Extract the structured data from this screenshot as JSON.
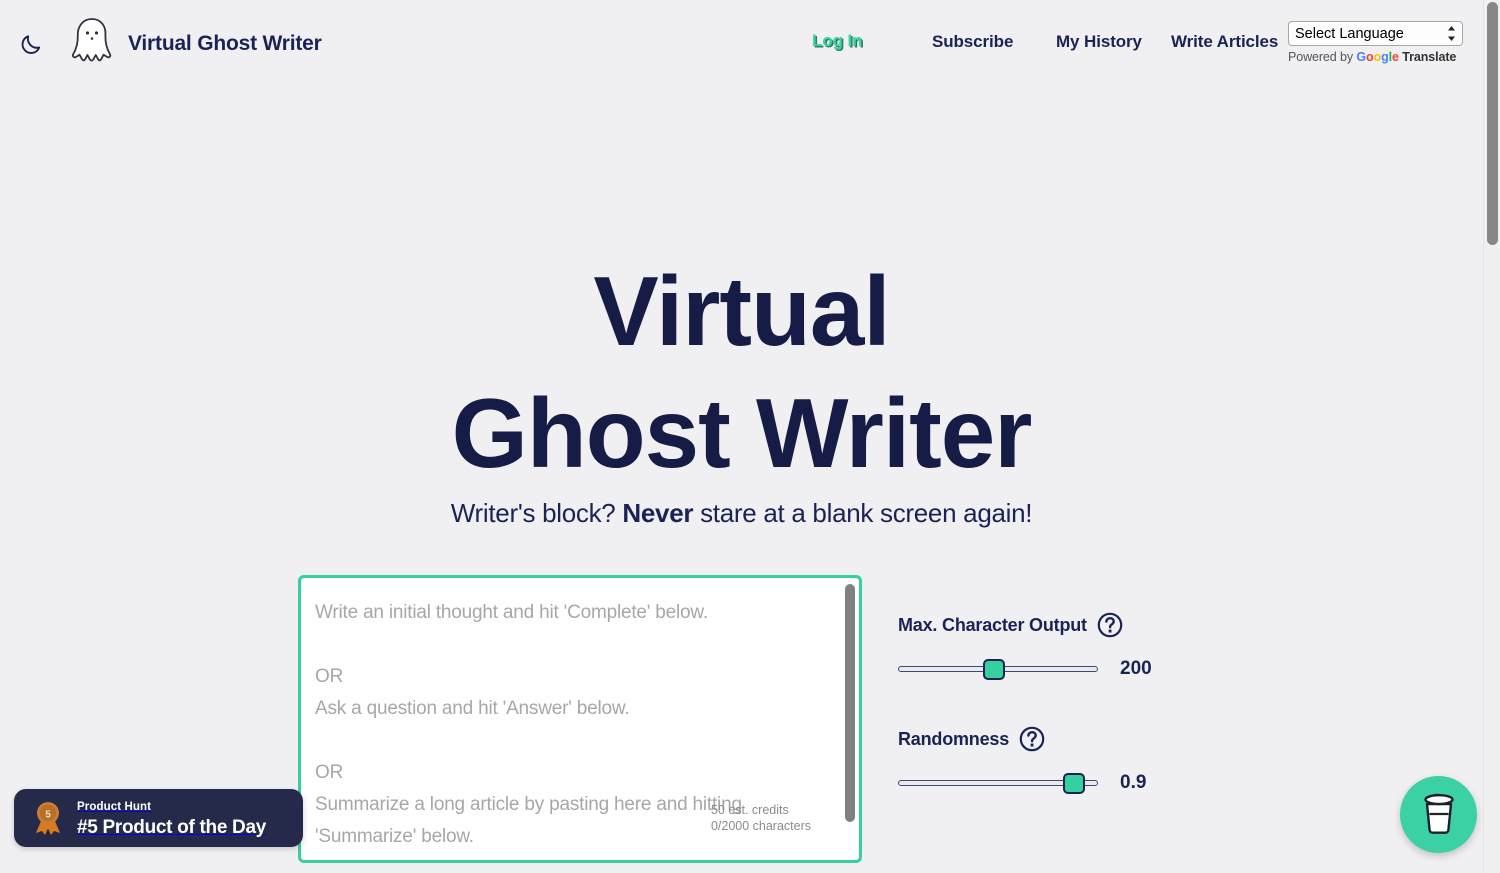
{
  "brand": {
    "name": "Virtual Ghost Writer",
    "logo_icon": "ghost-icon",
    "theme_toggle_icon": "moon-icon"
  },
  "nav": {
    "login": "Log In",
    "subscribe": "Subscribe",
    "history": "My History",
    "write": "Write Articles",
    "login_color": "#3cd0a5",
    "text_color": "#1b2356"
  },
  "translate": {
    "selected": "Select Language",
    "options": [
      "Select Language"
    ],
    "powered_prefix": "Powered by",
    "google": "Google",
    "google_letters": [
      "G",
      "o",
      "o",
      "g",
      "l",
      "e"
    ],
    "translate_word": "Translate"
  },
  "hero": {
    "title_line1": "Virtual",
    "title_line2": "Ghost Writer",
    "sub_part1": "Writer's block? ",
    "sub_strong": "Never",
    "sub_part2": " stare at a blank screen again!"
  },
  "composer": {
    "placeholder": "Write an initial thought and hit 'Complete' below.\n\nOR\nAsk a question and hit 'Answer' below.\n\nOR\nSummarize a long article by pasting here and hitting 'Summarize' below.",
    "value": "",
    "credits": "50 est. credits",
    "characters": "0/2000 characters",
    "border_color": "#35cfa0"
  },
  "controls": [
    {
      "label": "Max. Character Output",
      "help_icon": "question-circle-icon",
      "value": "200",
      "thumb_percent": 48
    },
    {
      "label": "Randomness",
      "help_icon": "question-circle-icon",
      "value": "0.9",
      "thumb_percent": 88
    }
  ],
  "product_hunt": {
    "medal_icon": "medal-icon",
    "medal_number": "5",
    "top_label": "Product Hunt",
    "main_label": "#5 Product of the Day",
    "background": "#262a4a"
  },
  "coffee_button": {
    "icon": "coffee-cup-icon",
    "color": "#3cd0a5"
  }
}
